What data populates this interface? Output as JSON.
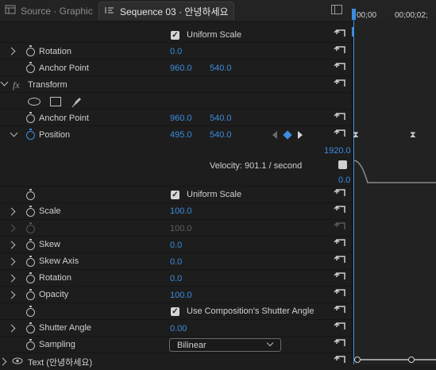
{
  "tabs": [
    {
      "label": "Source · Graphic",
      "active": false
    },
    {
      "label": "Sequence 03 · 안녕하세요",
      "active": true
    }
  ],
  "timeline": {
    "time_start": "00;00",
    "time_end": "00;00;02;"
  },
  "rows": {
    "uniform_scale_top": "Uniform Scale",
    "rotation_top": {
      "label": "Rotation",
      "value": "0.0"
    },
    "anchor_top": {
      "label": "Anchor Point",
      "x": "960.0",
      "y": "540.0"
    },
    "transform": {
      "label": "Transform",
      "fx": "fx"
    },
    "anchor": {
      "label": "Anchor Point",
      "x": "960.0",
      "y": "540.0"
    },
    "position": {
      "label": "Position",
      "x": "495.0",
      "y": "540.0"
    },
    "velocity": {
      "text": "Velocity: 901.1 / second",
      "max": "1920.0",
      "min": "0.0"
    },
    "uniform_scale": "Uniform Scale",
    "scale": {
      "label": "Scale",
      "value": "100.0"
    },
    "scale_width": {
      "value": "100.0"
    },
    "skew": {
      "label": "Skew",
      "value": "0.0"
    },
    "skew_axis": {
      "label": "Skew Axis",
      "value": "0.0"
    },
    "rotation": {
      "label": "Rotation",
      "value": "0.0"
    },
    "opacity": {
      "label": "Opacity",
      "value": "100.0"
    },
    "shutter_comp": "Use Composition's Shutter Angle",
    "shutter_angle": {
      "label": "Shutter Angle",
      "value": "0.00"
    },
    "sampling": {
      "label": "Sampling",
      "value": "Bilinear"
    },
    "text_layer": {
      "label": "Text (안녕하세요)"
    }
  },
  "colors": {
    "accent": "#3d8de0",
    "background": "#1d1d1d"
  }
}
